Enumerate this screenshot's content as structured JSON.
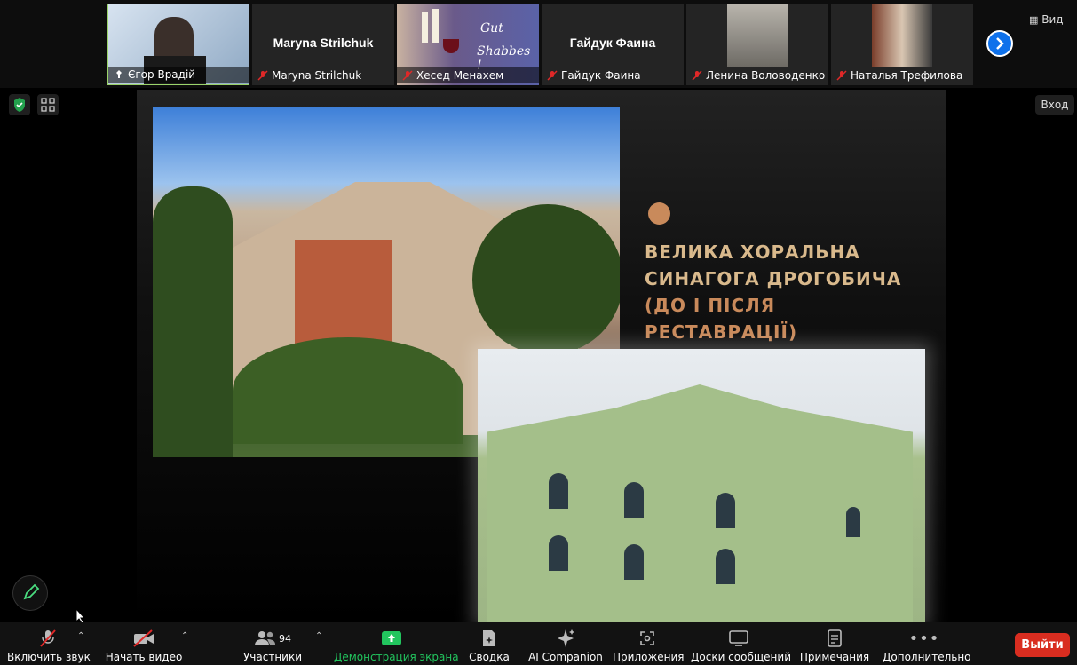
{
  "participants": [
    {
      "name": "Єгор Врадій",
      "type": "video",
      "muted": false
    },
    {
      "name": "Maryna Strilchuk",
      "display": "Maryna Strilchuk",
      "type": "name",
      "muted": true
    },
    {
      "name": "Хесед Менахем",
      "type": "image",
      "image_text_1": "Gut",
      "image_text_2": "Shabbes !",
      "muted": true
    },
    {
      "name": "Гайдук Фаина",
      "display": "Гайдук Фаина",
      "type": "name",
      "muted": true
    },
    {
      "name": "Ленина Воловоденко",
      "type": "video",
      "muted": true
    },
    {
      "name": "Наталья Трефилова",
      "type": "video",
      "muted": true
    }
  ],
  "view_label": "Вид",
  "enter_label": "Вход",
  "slide": {
    "title_line1": "ВЕЛИКА ХОРАЛЬНА",
    "title_line2": "СИНАГОГА ДРОГОБИЧА",
    "title_line3": "(ДО І ПІСЛЯ РЕСТАВРАЦІЇ)",
    "accent_color": "#c98a5b",
    "title_color": "#d9b98c"
  },
  "toolbar": {
    "unmute": "Включить звук",
    "start_video": "Начать видео",
    "participants": "Участники",
    "participants_count": "94",
    "share_screen": "Демонстрация экрана",
    "summary": "Сводка",
    "ai": "AI Companion",
    "apps": "Приложения",
    "whiteboards": "Доски сообщений",
    "notes": "Примечания",
    "more": "Дополнительно",
    "leave": "Выйти",
    "share_color": "#22c55e",
    "leave_color": "#d92d20"
  }
}
